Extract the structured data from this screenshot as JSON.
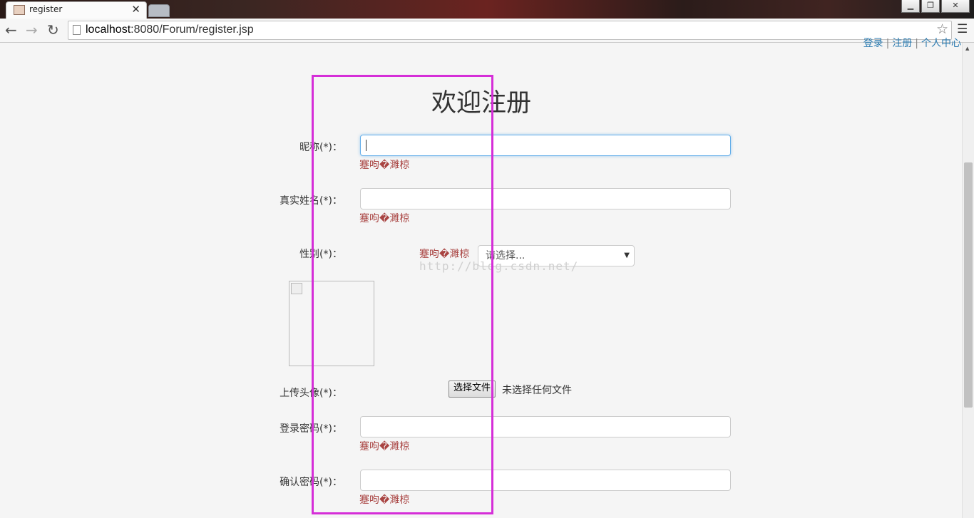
{
  "browser": {
    "tab_title": "register",
    "tab_close": "✕",
    "url_host": "localhost",
    "url_rest": ":8080/Forum/register.jsp",
    "window_controls": [
      "▁",
      "❐",
      "✕"
    ],
    "icons": [
      "back-icon",
      "forward-icon",
      "reload-icon",
      "page-icon",
      "star-icon",
      "menu-icon"
    ]
  },
  "nav_links": [
    "登录",
    "注册",
    "个人中心"
  ],
  "form": {
    "heading": "欢迎注册",
    "nickname_label": "昵称(*)：",
    "realname_label": "真实姓名(*)：",
    "gender_label": "性别(*)：",
    "avatar_label": "上传头像(*)：",
    "password_label": "登录密码(*)：",
    "confirm_label": "确认密码(*)：",
    "error_text": "蹇呴�濉椋",
    "gender_select": "请选择...",
    "file_button": "选择文件",
    "file_status": "未选择任何文件"
  },
  "watermark": "http://blog.csdn.net/",
  "colors": {
    "error": "#a94442",
    "highlight": "#d52ed8",
    "link": "#2a7ab0",
    "focus": "#66afe9"
  }
}
